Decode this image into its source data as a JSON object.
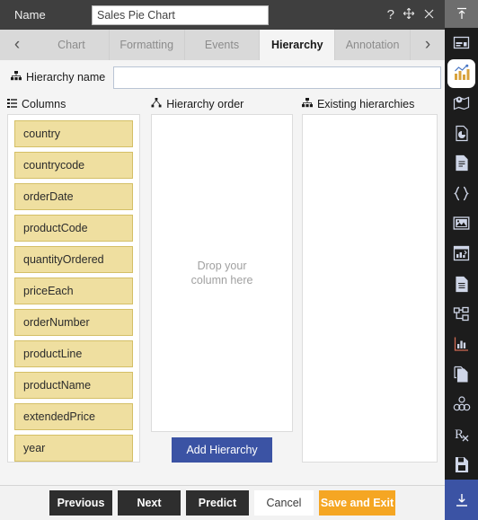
{
  "titlebar": {
    "label": "Name",
    "name_value": "Sales Pie Chart",
    "name_placeholder": "Name",
    "help_icon": "question-mark-icon",
    "move_icon": "move-icon",
    "close_icon": "close-icon"
  },
  "tabs": {
    "prev_arrow": "‹",
    "next_arrow": "›",
    "items": [
      {
        "label": "Chart",
        "selected": false
      },
      {
        "label": "Formatting",
        "selected": false
      },
      {
        "label": "Events",
        "selected": false
      },
      {
        "label": "Hierarchy",
        "selected": true
      },
      {
        "label": "Annotation",
        "selected": false
      }
    ]
  },
  "form": {
    "hierarchy_name_label": "Hierarchy name",
    "hierarchy_name_value": "",
    "hierarchy_name_placeholder": ""
  },
  "columns_panel": {
    "title": "Columns",
    "items": [
      "country",
      "countrycode",
      "orderDate",
      "productCode",
      "quantityOrdered",
      "priceEach",
      "orderNumber",
      "productLine",
      "productName",
      "extendedPrice",
      "year",
      ""
    ]
  },
  "hierarchy_order_panel": {
    "title": "Hierarchy order",
    "drop_text": "Drop your\ncolumn here",
    "add_button": "Add Hierarchy"
  },
  "existing_panel": {
    "title": "Existing hierarchies",
    "items": []
  },
  "footer": {
    "previous": "Previous",
    "next": "Next",
    "predict": "Predict",
    "cancel": "Cancel",
    "save_and_exit": "Save and Exit"
  },
  "rail": {
    "icons": [
      "collapse-up-icon",
      "panel-layout-icon",
      "chart-bar-icon",
      "map-pin-icon",
      "document-chart-icon",
      "document-text-icon",
      "code-braces-icon",
      "image-icon",
      "window-chart-icon",
      "document-list-icon",
      "tree-structure-icon",
      "line-chart-icon",
      "copy-document-icon",
      "cluster-icon",
      "prescription-icon",
      "save-document-icon",
      "download-icon"
    ]
  },
  "colors": {
    "accent_blue": "#3b53a4",
    "amber": "#f5a623",
    "chip_yellow": "#efdfa0",
    "titlebar": "#3f3f3f",
    "rail": "#1c1c1c"
  }
}
